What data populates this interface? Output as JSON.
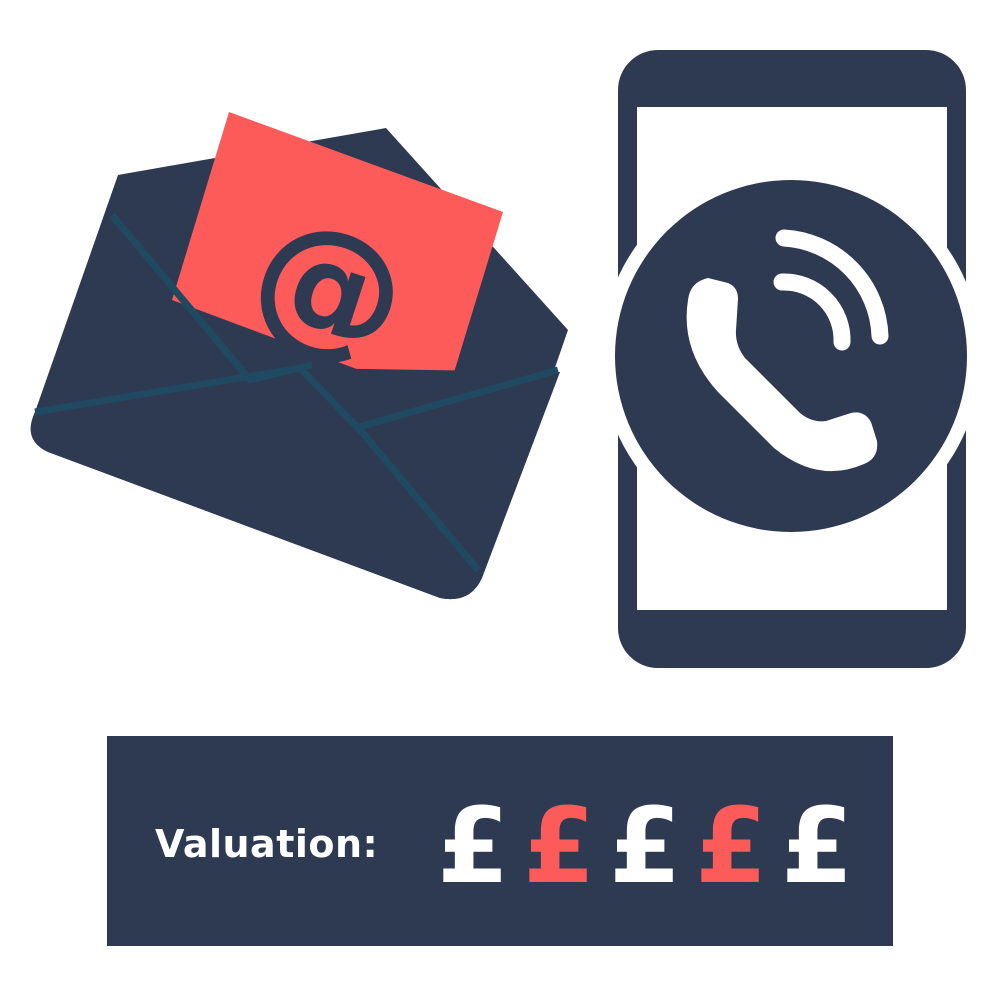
{
  "colors": {
    "navy": "#2e3a52",
    "red": "#fd5a5a",
    "white": "#ffffff",
    "teal": "#1f4a62"
  },
  "icons": {
    "envelope": "email-envelope-icon",
    "letter": "at-sign-letter-icon",
    "phone": "mobile-phone-icon",
    "call": "phone-call-icon"
  },
  "email_letter": {
    "symbol": "@"
  },
  "valuation": {
    "label": "Valuation:",
    "rating": 2,
    "max": 5,
    "symbols": [
      {
        "glyph": "£",
        "color": "#ffffff"
      },
      {
        "glyph": "£",
        "color": "#fd5a5a"
      },
      {
        "glyph": "£",
        "color": "#ffffff"
      },
      {
        "glyph": "£",
        "color": "#fd5a5a"
      },
      {
        "glyph": "£",
        "color": "#ffffff"
      }
    ]
  }
}
